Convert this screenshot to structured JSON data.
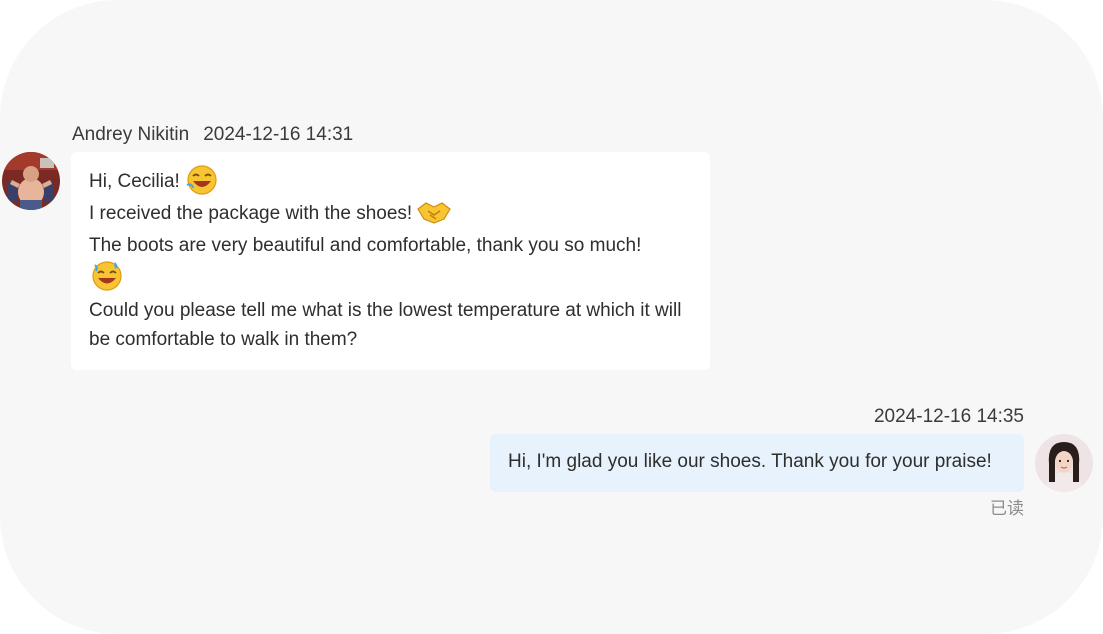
{
  "colors": {
    "background": "#f7f7f7",
    "incoming_bubble": "#ffffff",
    "outgoing_bubble": "#e7f2fd",
    "text": "#2e2e2e",
    "meta_text": "#3b3b3b",
    "read_status": "#8c8c8c"
  },
  "messages": [
    {
      "direction": "incoming",
      "sender": "Andrey Nikitin",
      "timestamp": "2024-12-16 14:31",
      "avatar_icon": "user-avatar-icon",
      "lines": [
        {
          "text": "Hi, Cecilia!",
          "emoji": "laughing-emoji-icon"
        },
        {
          "text": "I received the package with the shoes!",
          "emoji": "handshake-emoji-icon"
        },
        {
          "text": "The boots are very beautiful and comfortable, thank you so much!",
          "emoji": "sweat-smile-emoji-icon"
        },
        {
          "text": "Could you please tell me what is the lowest temperature at which it will be comfortable to walk in them?"
        }
      ]
    },
    {
      "direction": "outgoing",
      "timestamp": "2024-12-16 14:35",
      "avatar_icon": "agent-avatar-icon",
      "text": "Hi, I'm glad you like our shoes. Thank you for your praise!",
      "status": "已读"
    }
  ]
}
